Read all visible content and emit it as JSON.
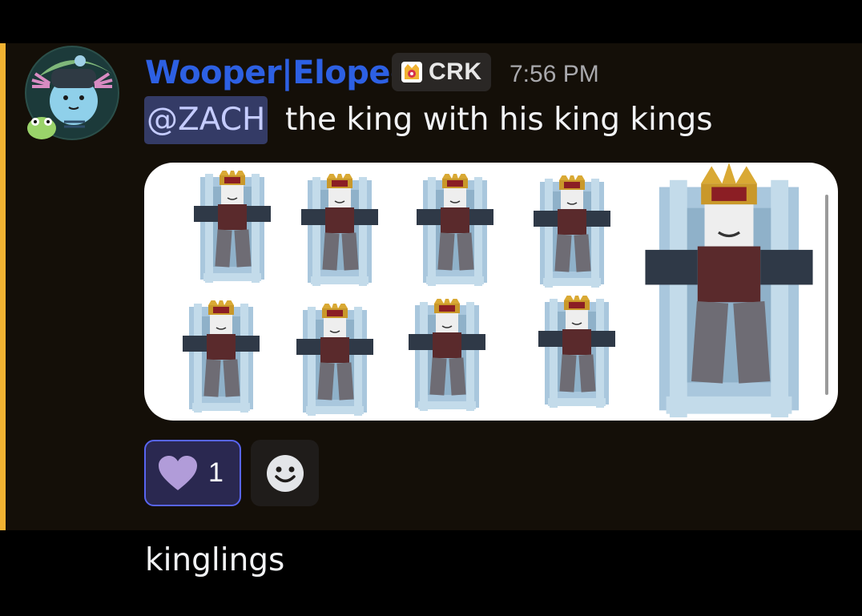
{
  "message": {
    "author": "Wooper|Eloped",
    "author_color": "#2d60e3",
    "clan_tag": "CRK",
    "timestamp": "7:56 PM",
    "mention": "@ZACH",
    "text": "the king with his king kings",
    "accent_color": "#f0b232",
    "avatar_icon": "wooper-avatar-icon",
    "attachment_icon": "king-throne-image"
  },
  "reactions": [
    {
      "emoji": "purple-heart-icon",
      "count": "1"
    }
  ],
  "add_reaction_icon": "smiley-add-reaction-icon",
  "next_message": {
    "text": "kinglings"
  }
}
